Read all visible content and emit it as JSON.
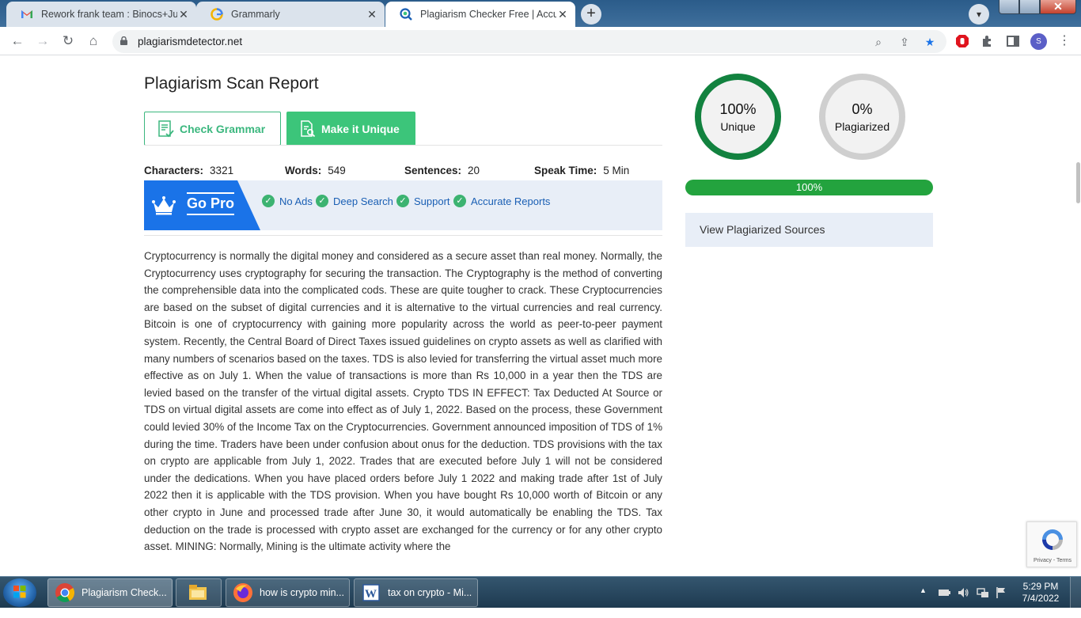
{
  "browser": {
    "tabs": [
      {
        "title": "Rework frank team : Binocs+June",
        "icon": "gmail-icon"
      },
      {
        "title": "Grammarly",
        "icon": "grammarly-icon"
      },
      {
        "title": "Plagiarism Checker Free | Accurate",
        "icon": "plagiarism-detector-icon"
      }
    ],
    "url": "plagiarismdetector.net",
    "profile_initial": "S"
  },
  "report": {
    "title": "Plagiarism Scan Report",
    "check_grammar_label": "Check Grammar",
    "make_unique_label": "Make it Unique",
    "stats": {
      "characters_label": "Characters:",
      "characters_value": "3321",
      "words_label": "Words:",
      "words_value": "549",
      "sentences_label": "Sentences:",
      "sentences_value": "20",
      "speak_time_label": "Speak Time:",
      "speak_time_value": "5 Min"
    },
    "go_pro": {
      "label": "Go Pro",
      "features": [
        "No Ads",
        "Deep Search",
        "Support",
        "Accurate Reports"
      ]
    },
    "body_text": "Cryptocurrency is normally the digital money and considered as a secure asset than real money. Normally, the Cryptocurrency uses cryptography for securing the transaction. The Cryptography is the method of converting the comprehensible data into the complicated cods. These are quite tougher to crack. These Cryptocurrencies are based on the subset of digital currencies and it is alternative to the virtual currencies and real currency. Bitcoin is one of cryptocurrency with gaining more popularity across the world as peer-to-peer payment system. Recently, the Central Board of Direct Taxes issued guidelines on crypto assets as well as clarified with many numbers of scenarios based on the taxes. TDS is also levied for transferring the virtual asset much more effective as on July 1. When the value of transactions is more than Rs 10,000 in a year then the TDS are levied based on the transfer of the virtual digital assets. Crypto TDS IN EFFECT: Tax Deducted At Source or TDS on virtual digital assets are come into effect as of July 1, 2022. Based on the process, these Government could levied 30% of the Income Tax on the Cryptocurrencies. Government announced imposition of TDS of 1% during the time. Traders have been under confusion about onus for the deduction. TDS provisions with the tax on crypto are applicable from July 1, 2022. Trades that are executed before July 1 will not be considered under the dedications. When you have placed orders before July 1 2022 and making trade after 1st of July 2022 then it is applicable with the TDS provision. When you have bought Rs 10,000 worth of Bitcoin or any other crypto in June and processed trade after June 30, it would automatically be enabling the TDS. Tax deduction on the trade is processed with crypto asset are exchanged for the currency or for any other crypto asset. MINING: Normally, Mining is the ultimate activity where the"
  },
  "results": {
    "unique_pct": "100%",
    "unique_label": "Unique",
    "plagiarized_pct": "0%",
    "plagiarized_label": "Plagiarized",
    "progress_label": "100%",
    "progress_value": 1.0,
    "view_sources_label": "View Plagiarized Sources",
    "unique_color": "#12823f",
    "plagiarized_color": "#cfcfcf"
  },
  "recaptcha": {
    "footer": "Privacy - Terms"
  },
  "taskbar": {
    "items": [
      {
        "label": "Plagiarism Check...",
        "icon": "chrome-icon"
      },
      {
        "label": "",
        "icon": "file-explorer-icon"
      },
      {
        "label": "how is crypto min...",
        "icon": "firefox-icon"
      },
      {
        "label": "tax on crypto - Mi...",
        "icon": "word-icon"
      }
    ],
    "time": "5:29 PM",
    "date": "7/4/2022"
  }
}
